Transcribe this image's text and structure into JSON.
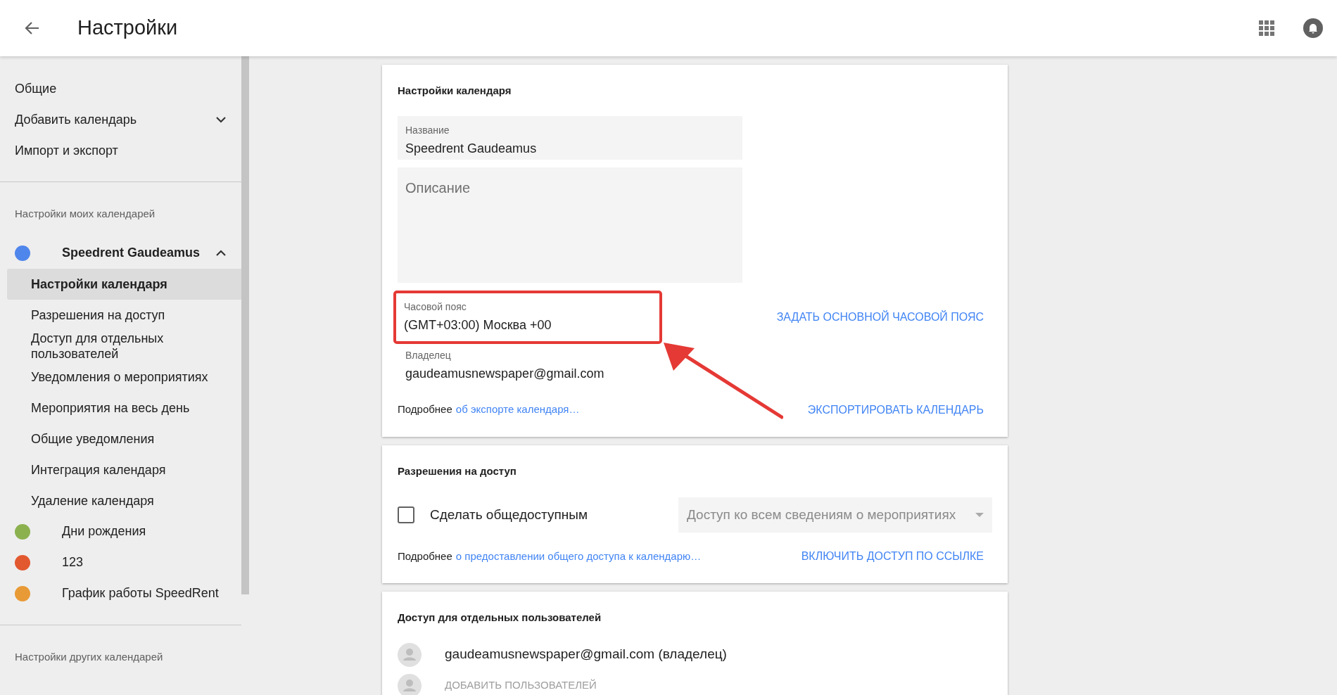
{
  "header": {
    "title": "Настройки"
  },
  "sidebar": {
    "items": [
      {
        "label": "Общие"
      },
      {
        "label": "Добавить календарь",
        "expanded": false
      },
      {
        "label": "Импорт и экспорт"
      }
    ],
    "my_calendars_heading": "Настройки моих календарей",
    "calendars": [
      {
        "name": "Speedrent Gaudeamus",
        "color": "#4f86ec",
        "expanded": true,
        "children": [
          {
            "label": "Настройки календаря",
            "selected": true
          },
          {
            "label": "Разрешения на доступ",
            "selected": false
          },
          {
            "label": "Доступ для отдельных пользователей",
            "selected": false
          },
          {
            "label": "Уведомления о мероприятиях",
            "selected": false
          },
          {
            "label": "Мероприятия на весь день",
            "selected": false
          },
          {
            "label": "Общие уведомления",
            "selected": false
          },
          {
            "label": "Интеграция календаря",
            "selected": false
          },
          {
            "label": "Удаление календаря",
            "selected": false
          }
        ]
      },
      {
        "name": "Дни рождения",
        "color": "#8bb14f",
        "expanded": false
      },
      {
        "name": "123",
        "color": "#e2582f",
        "expanded": false
      },
      {
        "name": "График работы SpeedRent",
        "color": "#e89a36",
        "expanded": false
      }
    ],
    "other_calendars_heading": "Настройки других календарей"
  },
  "calendar_settings": {
    "title": "Настройки календаря",
    "name_field": {
      "label": "Название",
      "value": "Speedrent Gaudeamus"
    },
    "description_field": {
      "placeholder": "Описание"
    },
    "timezone": {
      "label": "Часовой пояс",
      "value": "(GMT+03:00) Москва +00",
      "action": "ЗАДАТЬ ОСНОВНОЙ ЧАСОВОЙ ПОЯС",
      "highlighted": true
    },
    "owner": {
      "label": "Владелец",
      "value": "gaudeamusnewspaper@gmail.com"
    },
    "more_prefix": "Подробнее",
    "more_link": "об экспорте календаря…",
    "export_button": "ЭКСПОРТИРОВАТЬ КАЛЕНДАРЬ"
  },
  "access_permissions": {
    "title": "Разрешения на доступ",
    "public_checkbox": {
      "label": "Сделать общедоступным",
      "checked": false
    },
    "access_select": {
      "value": "Доступ ко всем сведениям о мероприятиях",
      "disabled": true
    },
    "more_prefix": "Подробнее",
    "more_link": "о предоставлении общего доступа к календарю…",
    "link_button": "ВКЛЮЧИТЬ ДОСТУП ПО ССЫЛКЕ"
  },
  "user_access": {
    "title": "Доступ для отдельных пользователей",
    "users": [
      "gaudeamusnewspaper@gmail.com (владелец)"
    ],
    "add_button": "ДОБАВИТЬ ПОЛЬЗОВАТЕЛЕЙ"
  }
}
